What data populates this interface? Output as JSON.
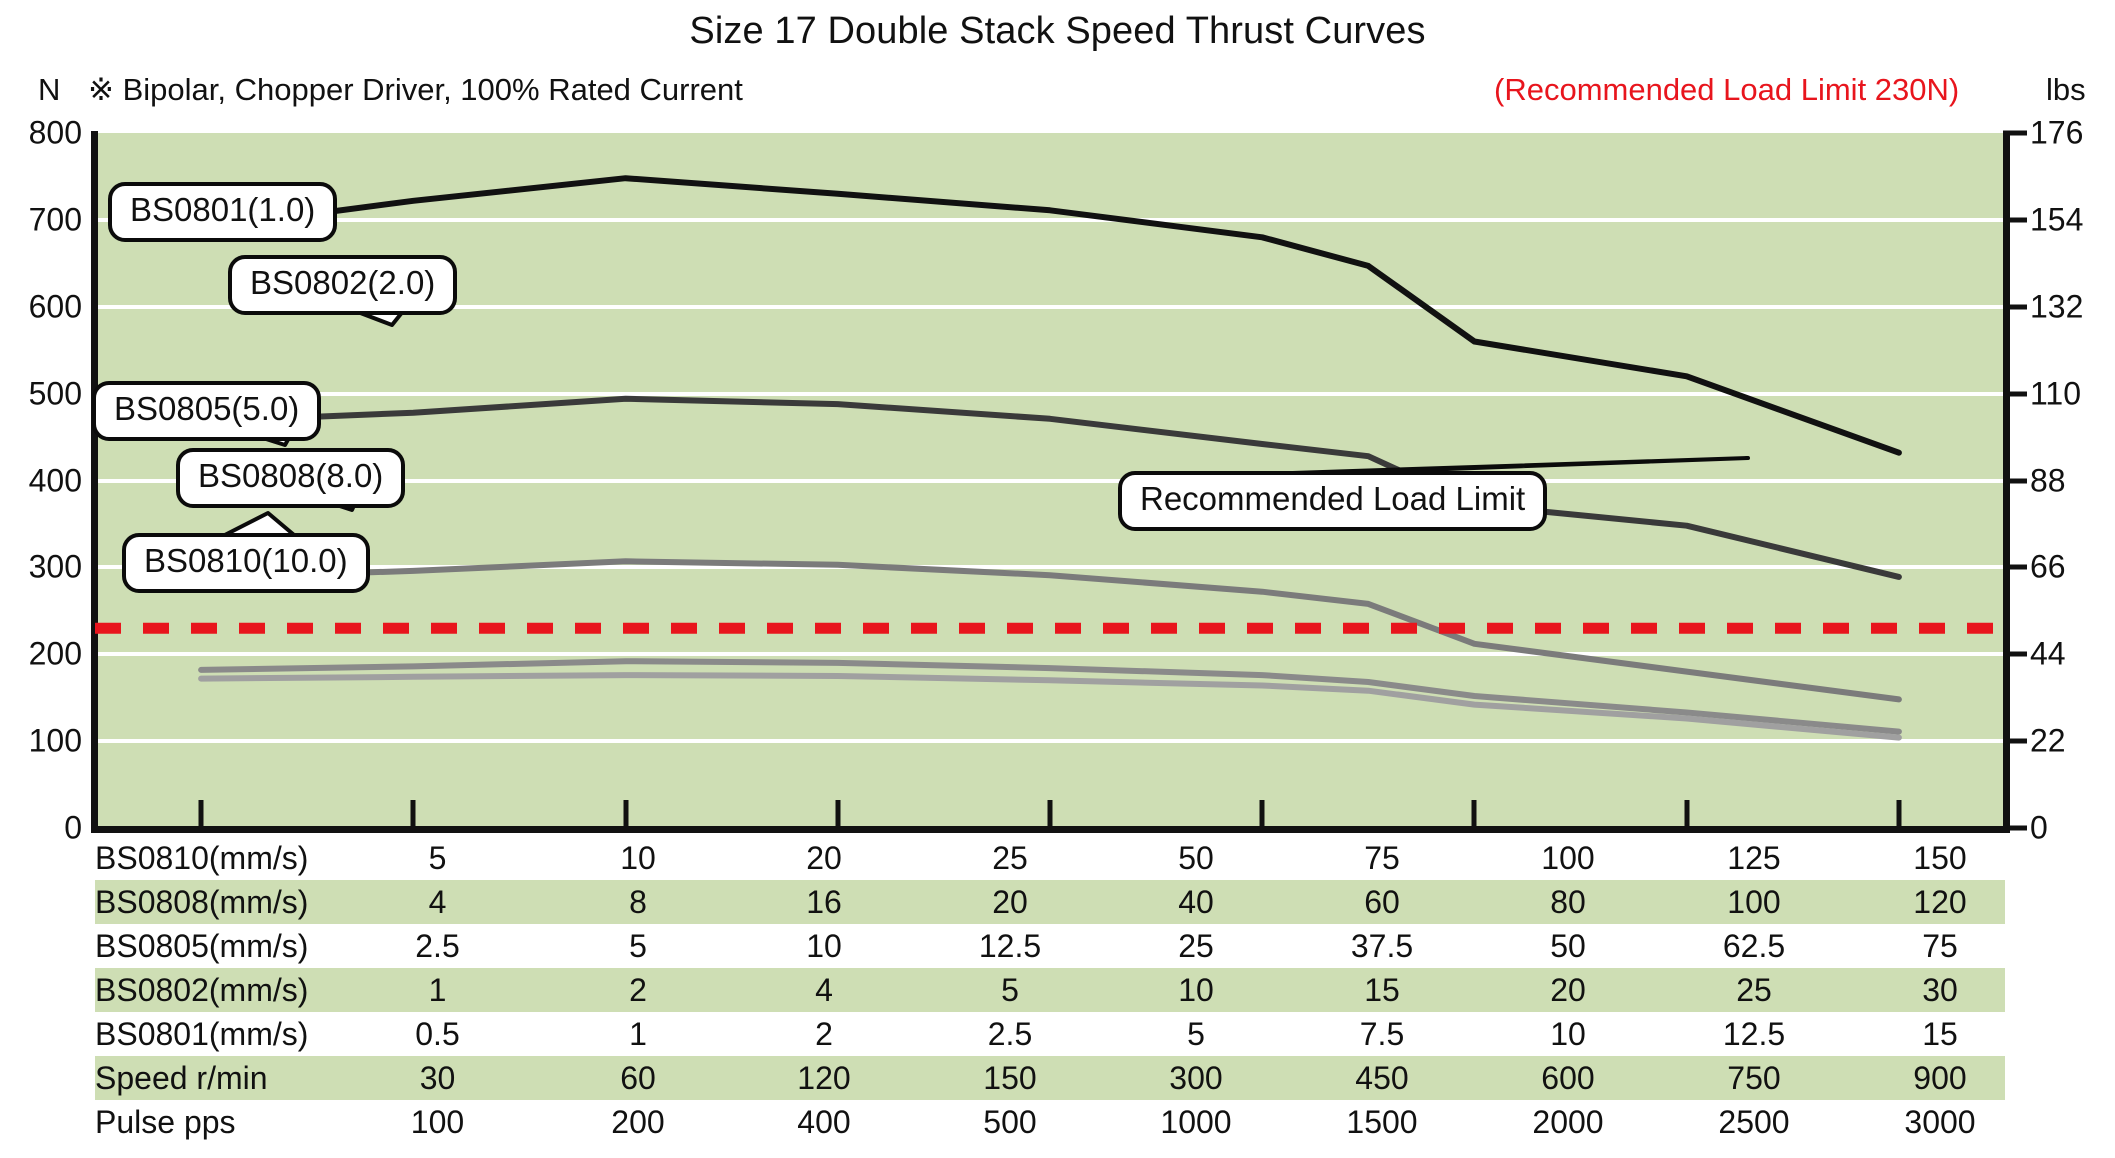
{
  "header": {
    "title": "Size 17 Double Stack Speed Thrust Curves",
    "unit_left": "N",
    "unit_right": "lbs",
    "note": "※ Bipolar, Chopper Driver, 100% Rated Current",
    "load_limit_note": "(Recommended Load Limit 230N)",
    "load_limit_color": "#e8151d"
  },
  "axes": {
    "left_ticks": [
      "800",
      "700",
      "600",
      "500",
      "400",
      "300",
      "200",
      "100",
      "0"
    ],
    "right_ticks": [
      "176",
      "154",
      "132",
      "110",
      "88",
      "66",
      "44",
      "22",
      "0"
    ],
    "left_unit": "N",
    "right_unit": "lbs"
  },
  "callouts": [
    {
      "id": "bs0801",
      "label": "BS0801(1.0)"
    },
    {
      "id": "bs0802",
      "label": "BS0802(2.0)"
    },
    {
      "id": "bs0805",
      "label": "BS0805(5.0)"
    },
    {
      "id": "bs0808",
      "label": "BS0808(8.0)"
    },
    {
      "id": "bs0810",
      "label": "BS0810(10.0)"
    },
    {
      "id": "load-limit",
      "label": "Recommended Load Limit"
    }
  ],
  "table": {
    "rows": [
      {
        "label": "BS0810(mm/s)",
        "shaded": false,
        "values": [
          "5",
          "10",
          "20",
          "25",
          "50",
          "75",
          "100",
          "125",
          "150"
        ]
      },
      {
        "label": "BS0808(mm/s)",
        "shaded": true,
        "values": [
          "4",
          "8",
          "16",
          "20",
          "40",
          "60",
          "80",
          "100",
          "120"
        ]
      },
      {
        "label": "BS0805(mm/s)",
        "shaded": false,
        "values": [
          "2.5",
          "5",
          "10",
          "12.5",
          "25",
          "37.5",
          "50",
          "62.5",
          "75"
        ]
      },
      {
        "label": "BS0802(mm/s)",
        "shaded": true,
        "values": [
          "1",
          "2",
          "4",
          "5",
          "10",
          "15",
          "20",
          "25",
          "30"
        ]
      },
      {
        "label": "BS0801(mm/s)",
        "shaded": false,
        "values": [
          "0.5",
          "1",
          "2",
          "2.5",
          "5",
          "7.5",
          "10",
          "12.5",
          "15"
        ]
      },
      {
        "label": "Speed  r/min",
        "shaded": true,
        "values": [
          "30",
          "60",
          "120",
          "150",
          "300",
          "450",
          "600",
          "750",
          "900"
        ]
      },
      {
        "label": "Pulse   pps",
        "shaded": false,
        "values": [
          "100",
          "200",
          "400",
          "500",
          "1000",
          "1500",
          "2000",
          "2500",
          "3000"
        ]
      }
    ]
  },
  "chart_data": {
    "type": "line",
    "title": "Size 17 Double Stack Speed Thrust Curves",
    "subtitle": "※ Bipolar, Chopper Driver, 100% Rated Current",
    "xlabel": "Pulse pps / Speed r/min",
    "ylabel": "N",
    "ylabel_right": "lbs",
    "ylim": [
      0,
      800
    ],
    "ylim_right": [
      0,
      176
    ],
    "grid": true,
    "legend": "inline callouts",
    "x": [
      100,
      200,
      400,
      500,
      1000,
      1500,
      2000,
      2500,
      3000
    ],
    "x_tick_labels": [
      "100",
      "200",
      "400",
      "500",
      "1000",
      "1500",
      "2000",
      "2500",
      "3000"
    ],
    "series": [
      {
        "name": "BS0801(1.0)",
        "color": "#111111",
        "values": [
          690,
          722,
          748,
          730,
          711,
          680,
          647,
          560,
          520,
          432
        ],
        "x_values": [
          100,
          200,
          400,
          500,
          1000,
          1500,
          1750,
          2000,
          2500,
          3000
        ],
        "note": "thrust in N; falls from ~690N at 100pps, peaks ~748N at 400pps, ends ~432N at 3000pps"
      },
      {
        "name": "BS0802(2.0)",
        "color": "#3a3a3a",
        "values": [
          468,
          478,
          494,
          488,
          471,
          442,
          428,
          372,
          348,
          289
        ],
        "x_values": [
          100,
          200,
          400,
          500,
          1000,
          1500,
          1750,
          2000,
          2500,
          3000
        ],
        "note": "thrust in N; ~468N at 100pps, peak ~494N at 400pps, ends ~289N at 3000pps"
      },
      {
        "name": "BS0805(5.0)",
        "color": "#7b7b7b",
        "values": [
          288,
          296,
          307,
          303,
          291,
          272,
          258,
          212,
          180,
          148
        ],
        "x_values": [
          100,
          200,
          400,
          500,
          1000,
          1500,
          1750,
          2000,
          2500,
          3000
        ],
        "note": "thrust in N; crosses the 230N recommended load limit near 2000pps"
      },
      {
        "name": "BS0808(8.0)",
        "color": "#8a8a8a",
        "values": [
          182,
          186,
          192,
          190,
          184,
          176,
          168,
          152,
          133,
          111
        ],
        "x_values": [
          100,
          200,
          400,
          500,
          1000,
          1500,
          1750,
          2000,
          2500,
          3000
        ],
        "note": "thrust in N"
      },
      {
        "name": "BS0810(10.0)",
        "color": "#a0a0a0",
        "values": [
          172,
          174,
          176,
          175,
          170,
          164,
          158,
          142,
          126,
          104
        ],
        "x_values": [
          100,
          200,
          400,
          500,
          1000,
          1500,
          1750,
          2000,
          2500,
          3000
        ],
        "note": "thrust in N"
      }
    ],
    "reference_line": {
      "label": "Recommended Load Limit",
      "value": 230,
      "unit": "N",
      "color": "#e8151d",
      "style": "dashed"
    },
    "table": {
      "row_headers": [
        "BS0810(mm/s)",
        "BS0808(mm/s)",
        "BS0805(mm/s)",
        "BS0802(mm/s)",
        "BS0801(mm/s)",
        "Speed  r/min",
        "Pulse   pps"
      ],
      "rows": [
        [
          "5",
          "10",
          "20",
          "25",
          "50",
          "75",
          "100",
          "125",
          "150"
        ],
        [
          "4",
          "8",
          "16",
          "20",
          "40",
          "60",
          "80",
          "100",
          "120"
        ],
        [
          "2.5",
          "5",
          "10",
          "12.5",
          "25",
          "37.5",
          "50",
          "62.5",
          "75"
        ],
        [
          "1",
          "2",
          "4",
          "5",
          "10",
          "15",
          "20",
          "25",
          "30"
        ],
        [
          "0.5",
          "1",
          "2",
          "2.5",
          "5",
          "7.5",
          "10",
          "12.5",
          "15"
        ],
        [
          "30",
          "60",
          "120",
          "150",
          "300",
          "450",
          "600",
          "750",
          "900"
        ],
        [
          "100",
          "200",
          "400",
          "500",
          "1000",
          "1500",
          "2000",
          "2500",
          "3000"
        ]
      ]
    }
  }
}
